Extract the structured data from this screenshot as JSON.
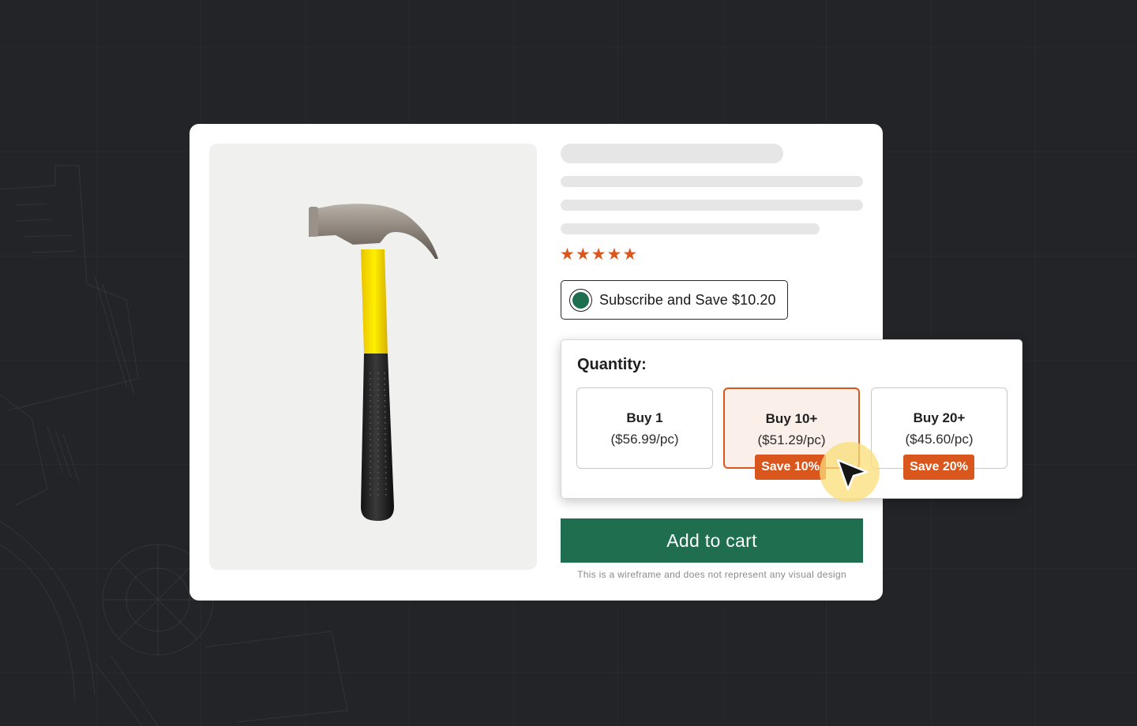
{
  "product": {
    "image_alt": "claw-hammer",
    "rating_stars": [
      "★",
      "★",
      "★",
      "★",
      "★"
    ],
    "rating_color": "#d9561c"
  },
  "subscribe": {
    "label": "Subscribe and Save $10.20",
    "selected": true,
    "radio_color": "#1e6e50"
  },
  "quantity": {
    "title": "Quantity:",
    "options": [
      {
        "label": "Buy 1",
        "price": "($56.99/pc)",
        "badge": ""
      },
      {
        "label": "Buy 10+",
        "price": "($51.29/pc)",
        "badge": "Save 10%",
        "selected": true
      },
      {
        "label": "Buy 20+",
        "price": "($45.60/pc)",
        "badge": "Save 20%"
      }
    ],
    "accent_color": "#d9561c"
  },
  "cart": {
    "button_label": "Add to cart",
    "button_color": "#1f6e50",
    "disclaimer": "This is a wireframe and does not represent any visual design"
  }
}
